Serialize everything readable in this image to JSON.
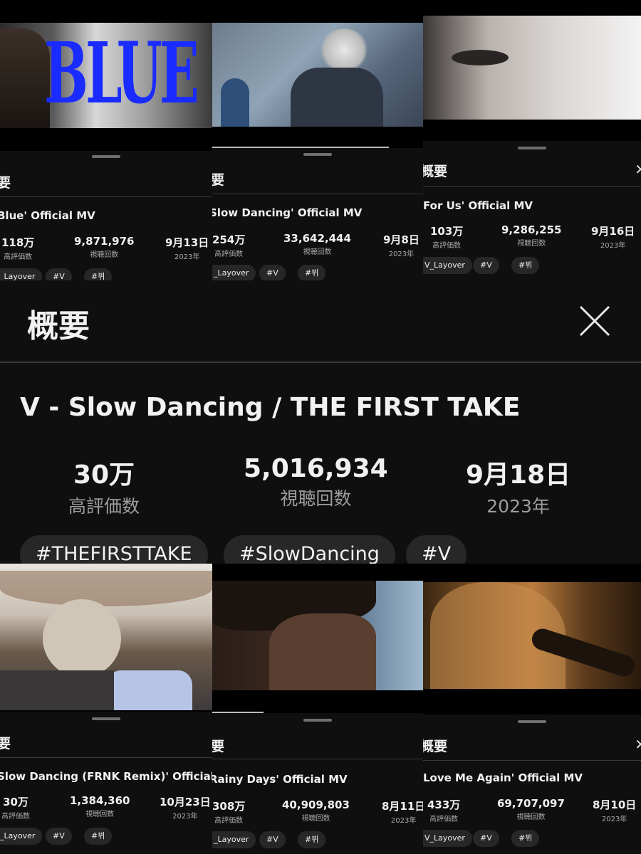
{
  "top": [
    {
      "thumb_text": "BLUE",
      "sheet_title": "要",
      "video_title": "Blue' Official MV",
      "likes": "118万",
      "likes_label": "高評価数",
      "views": "9,871,976",
      "views_label": "視聴回数",
      "date": "9月13日",
      "year": "2023年",
      "tags": [
        "_Layover",
        "#V",
        "#뷔"
      ]
    },
    {
      "sheet_title": "要",
      "video_title": "Slow Dancing' Official MV",
      "likes": "254万",
      "likes_label": "高評価数",
      "views": "33,642,444",
      "views_label": "視聴回数",
      "date": "9月8日",
      "year": "2023年",
      "tags": [
        "_Layover",
        "#V",
        "#뷔"
      ]
    },
    {
      "sheet_title": "概要",
      "video_title": "For Us' Official MV",
      "likes": "103万",
      "likes_label": "高評価数",
      "views": "9,286,255",
      "views_label": "視聴回数",
      "date": "9月16日",
      "year": "2023年",
      "tags": [
        "V_Layover",
        "#V",
        "#뷔"
      ]
    }
  ],
  "main": {
    "sheet_title": "概要",
    "video_title": "V - Slow Dancing / THE FIRST TAKE",
    "likes": "30万",
    "likes_label": "高評価数",
    "views": "5,016,934",
    "views_label": "視聴回数",
    "date": "9月18日",
    "year": "2023年",
    "tags": [
      "#THEFIRSTTAKE",
      "#SlowDancing",
      "#V"
    ]
  },
  "bottom": [
    {
      "sheet_title": "要",
      "video_title": "Slow Dancing (FRNK Remix)' Official MV",
      "likes": "30万",
      "likes_label": "高評価数",
      "views": "1,384,360",
      "views_label": "視聴回数",
      "date": "10月23日",
      "year": "2023年",
      "tags": [
        "_Layover",
        "#V",
        "#뷔"
      ]
    },
    {
      "sheet_title": "要",
      "video_title": "Rainy Days' Official MV",
      "likes": "308万",
      "likes_label": "高評価数",
      "views": "40,909,803",
      "views_label": "視聴回数",
      "date": "8月11日",
      "year": "2023年",
      "tags": [
        "_Layover",
        "#V",
        "#뷔"
      ]
    },
    {
      "sheet_title": "概要",
      "video_title": "Love Me Again' Official MV",
      "likes": "433万",
      "likes_label": "高評価数",
      "views": "69,707,097",
      "views_label": "視聴回数",
      "date": "8月10日",
      "year": "2023年",
      "tags": [
        "V_Layover",
        "#V",
        "#뷔"
      ]
    }
  ],
  "colors": {
    "background": "#0f0f0f",
    "chip": "#272727",
    "blue_logo": "#1a2bff",
    "muted_text": "#aaaaaa"
  },
  "icons": {
    "close": "close-icon"
  }
}
